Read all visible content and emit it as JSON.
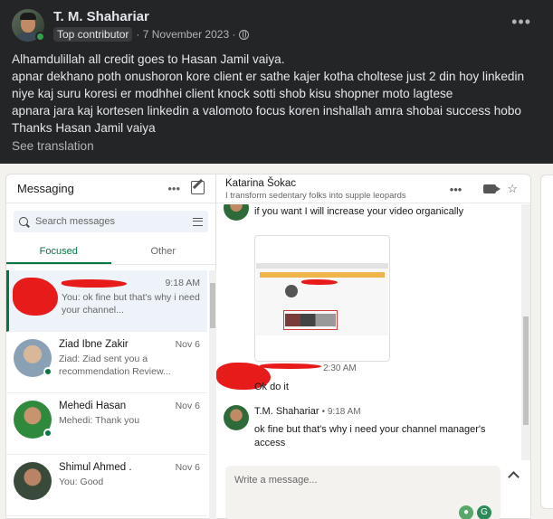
{
  "post": {
    "author": "T. M. Shahariar",
    "badge": "Top contributor",
    "date": "· 7 November 2023 ·",
    "lines": [
      "Alhamdulillah all credit goes to Hasan Jamil vaiya.",
      "apnar dekhano poth onushoron kore client er sathe kajer kotha  choltese just 2 din hoy linkedin",
      "niye kaj suru koresi er modhhei client knock sotti shob kisu shopner moto lagtese",
      "apnara jara kaj kortesen linkedin a valomoto focus koren inshallah amra shobai success hobo",
      "Thanks Hasan Jamil vaiya"
    ],
    "see_translation": "See translation",
    "more": "•••"
  },
  "messaging": {
    "title": "Messaging",
    "more": "•••",
    "search_placeholder": "Search messages",
    "tabs": [
      {
        "label": "Focused"
      },
      {
        "label": "Other"
      }
    ],
    "conversations": [
      {
        "name": "",
        "date": "9:18 AM",
        "snippet": "You: ok fine but that's why i need your channel..."
      },
      {
        "name": "Ziad Ibne Zakir",
        "date": "Nov 6",
        "snippet": "Ziad: Ziad sent you a recommendation Review..."
      },
      {
        "name": "Mehedi Hasan",
        "date": "Nov 6",
        "snippet": "Mehedi: Thank you"
      },
      {
        "name": "Shimul Ahmed .",
        "date": "Nov 6",
        "snippet": "You: Good"
      }
    ]
  },
  "chat": {
    "name": "Katarina Šokac",
    "headline": "I transform sedentary folks into supple leopards",
    "more": "•••",
    "messages": [
      {
        "text": "if you want I will increase your video organically"
      },
      {
        "time": "2:30 AM",
        "text": "Ok do it"
      },
      {
        "sender": "T.M. Shahariar",
        "time": "• 9:18 AM",
        "text": "ok fine but that's why i need your channel manager's access"
      }
    ],
    "compose_placeholder": "Write a message..."
  },
  "colors": {
    "facebook_bg": "#242526",
    "linkedin_green": "#057642",
    "redaction": "#e81b1b"
  }
}
